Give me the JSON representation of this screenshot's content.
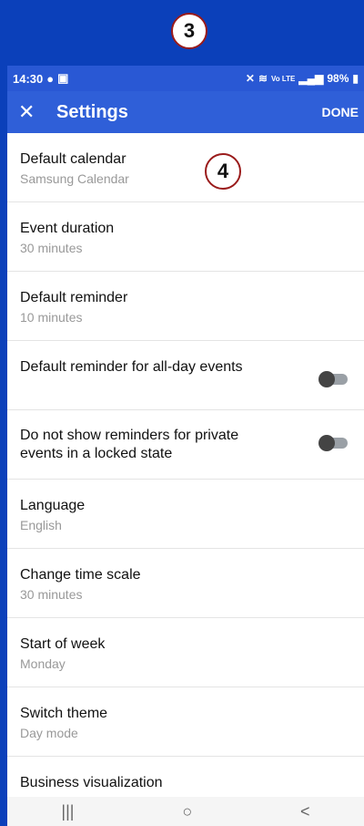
{
  "annotations": {
    "marker3": "3",
    "marker4": "4"
  },
  "status_bar": {
    "time": "14:30",
    "battery": "98%",
    "signal_text": "Vo LTE"
  },
  "toolbar": {
    "close_icon": "close-icon",
    "title": "Settings",
    "done_label": "DONE"
  },
  "settings": [
    {
      "title": "Default calendar",
      "subtitle": "Samsung Calendar"
    },
    {
      "title": "Event duration",
      "subtitle": "30 minutes"
    },
    {
      "title": "Default reminder",
      "subtitle": "10 minutes"
    },
    {
      "title": "Default reminder for all-day events",
      "toggle": "off"
    },
    {
      "title": "Do not show reminders for private events in a locked state",
      "toggle": "off"
    },
    {
      "title": "Language",
      "subtitle": "English"
    },
    {
      "title": "Change time scale",
      "subtitle": "30 minutes"
    },
    {
      "title": "Start of week",
      "subtitle": "Monday"
    },
    {
      "title": "Switch theme",
      "subtitle": "Day mode"
    },
    {
      "title": "Business visualization"
    }
  ],
  "navbar": {
    "recent": "|||",
    "home": "○",
    "back": "<"
  }
}
